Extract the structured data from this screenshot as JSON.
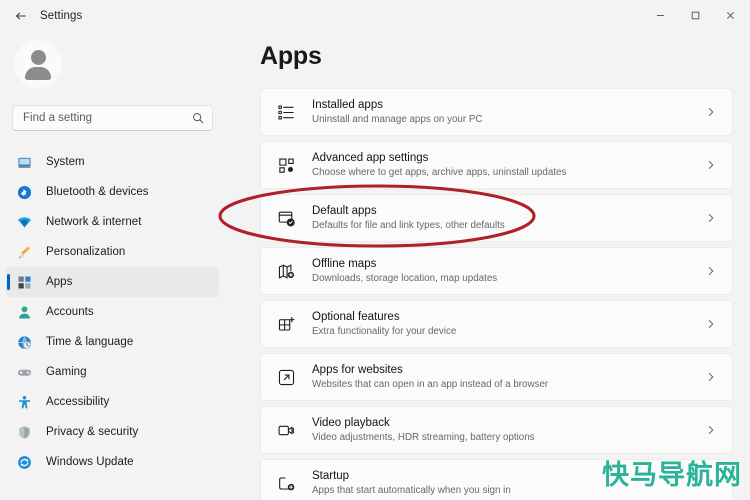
{
  "window": {
    "title": "Settings",
    "back_icon": "back-arrow-icon",
    "minimize_label": "–",
    "maximize_label": "□",
    "close_label": "✕"
  },
  "sidebar": {
    "avatar_name": "user-avatar",
    "search": {
      "placeholder": "Find a setting",
      "value": "",
      "icon": "search-icon"
    },
    "items": [
      {
        "label": "System",
        "icon": "monitor-icon",
        "selected": false
      },
      {
        "label": "Bluetooth & devices",
        "icon": "bluetooth-icon",
        "selected": false
      },
      {
        "label": "Network & internet",
        "icon": "wifi-icon",
        "selected": false
      },
      {
        "label": "Personalization",
        "icon": "paintbrush-icon",
        "selected": false
      },
      {
        "label": "Apps",
        "icon": "apps-icon",
        "selected": true
      },
      {
        "label": "Accounts",
        "icon": "person-icon",
        "selected": false
      },
      {
        "label": "Time & language",
        "icon": "globe-clock-icon",
        "selected": false
      },
      {
        "label": "Gaming",
        "icon": "gamepad-icon",
        "selected": false
      },
      {
        "label": "Accessibility",
        "icon": "accessibility-icon",
        "selected": false
      },
      {
        "label": "Privacy & security",
        "icon": "shield-icon",
        "selected": false
      },
      {
        "label": "Windows Update",
        "icon": "update-icon",
        "selected": false
      }
    ]
  },
  "main": {
    "heading": "Apps",
    "rows": [
      {
        "title": "Installed apps",
        "subtitle": "Uninstall and manage apps on your PC",
        "icon": "list-apps-icon",
        "chevron": "chevron-right-icon",
        "highlighted": false
      },
      {
        "title": "Advanced app settings",
        "subtitle": "Choose where to get apps, archive apps, uninstall updates",
        "icon": "advanced-app-settings-icon",
        "chevron": "chevron-right-icon",
        "highlighted": false
      },
      {
        "title": "Default apps",
        "subtitle": "Defaults for file and link types, other defaults",
        "icon": "default-apps-icon",
        "chevron": "chevron-right-icon",
        "highlighted": true
      },
      {
        "title": "Offline maps",
        "subtitle": "Downloads, storage location, map updates",
        "icon": "offline-maps-icon",
        "chevron": "chevron-right-icon",
        "highlighted": false
      },
      {
        "title": "Optional features",
        "subtitle": "Extra functionality for your device",
        "icon": "optional-features-icon",
        "chevron": "chevron-right-icon",
        "highlighted": false
      },
      {
        "title": "Apps for websites",
        "subtitle": "Websites that can open in an app instead of a browser",
        "icon": "apps-for-websites-icon",
        "chevron": "chevron-right-icon",
        "highlighted": false
      },
      {
        "title": "Video playback",
        "subtitle": "Video adjustments, HDR streaming, battery options",
        "icon": "video-playback-icon",
        "chevron": "chevron-right-icon",
        "highlighted": false
      },
      {
        "title": "Startup",
        "subtitle": "Apps that start automatically when you sign in",
        "icon": "startup-icon",
        "chevron": "chevron-right-icon",
        "highlighted": false
      }
    ]
  },
  "annotation": {
    "shape": "ellipse",
    "color": "#b02029",
    "target": "Default apps"
  },
  "watermark": {
    "text": "快马导航网",
    "color": "#2bb39a"
  },
  "colors": {
    "accent": "#0067c0",
    "window_bg": "#f3f3f3",
    "card_bg": "#fbfbfb",
    "annotation_red": "#b02029",
    "watermark_teal": "#2bb39a"
  }
}
